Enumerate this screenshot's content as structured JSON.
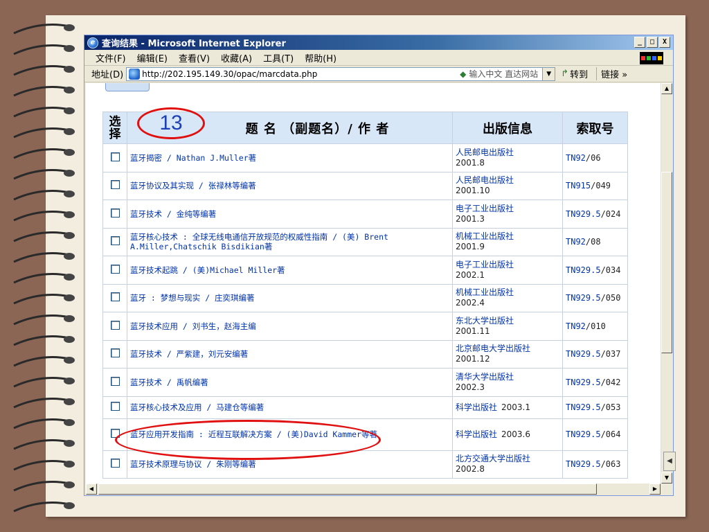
{
  "window": {
    "title": "查询结果 - Microsoft Internet Explorer",
    "minimize": "_",
    "maximize": "□",
    "close": "X"
  },
  "menu": {
    "items": [
      {
        "label": "文件(F)"
      },
      {
        "label": "编辑(E)"
      },
      {
        "label": "查看(V)"
      },
      {
        "label": "收藏(A)"
      },
      {
        "label": "工具(T)"
      },
      {
        "label": "帮助(H)"
      }
    ]
  },
  "address": {
    "label": "地址(D)",
    "url": "http://202.195.149.30/opac/marcdata.php",
    "hint": "输入中文 直达网站",
    "go_label": "转到",
    "links_label": "链接 »"
  },
  "table": {
    "headers": {
      "select": "选 择",
      "title": "题 名 （副题名）/ 作 者",
      "publication": "出版信息",
      "call_number": "索取号"
    },
    "rows": [
      {
        "title": "蓝牙揭密 / Nathan J.Muller著",
        "publisher": "人民邮电出版社",
        "year": "2001.8",
        "call_prefix": "TN92",
        "call_suffix": "/06"
      },
      {
        "title": "蓝牙协议及其实现 / 张禄林等编著",
        "publisher": "人民邮电出版社",
        "year": "2001.10",
        "call_prefix": "TN915",
        "call_suffix": "/049"
      },
      {
        "title": "蓝牙技术 / 金纯等编著",
        "publisher": "电子工业出版社",
        "year": "2001.3",
        "call_prefix": "TN929.5",
        "call_suffix": "/024"
      },
      {
        "title": "蓝牙核心技术 : 全球无线电通信开放规范的权威性指南 / (美) Brent A.Miller,Chatschik Bisdikian著",
        "publisher": "机械工业出版社",
        "year": "2001.9",
        "call_prefix": "TN92",
        "call_suffix": "/08"
      },
      {
        "title": "蓝牙技术起跳 / (美)Michael Miller著",
        "publisher": "电子工业出版社",
        "year": "2002.1",
        "call_prefix": "TN929.5",
        "call_suffix": "/034"
      },
      {
        "title": "蓝牙 : 梦想与现实 / 庄奕琪编著",
        "publisher": "机械工业出版社",
        "year": "2002.4",
        "call_prefix": "TN929.5",
        "call_suffix": "/050"
      },
      {
        "title": "蓝牙技术应用 / 刘书生，赵海主编",
        "publisher": "东北大学出版社",
        "year": "2001.11",
        "call_prefix": "TN92",
        "call_suffix": "/010"
      },
      {
        "title": "蓝牙技术 / 严紫建，刘元安编著",
        "publisher": "北京邮电大学出版社",
        "year": "2001.12",
        "call_prefix": "TN929.5",
        "call_suffix": "/037"
      },
      {
        "title": "蓝牙技术 / 禹帆编著",
        "publisher": "清华大学出版社",
        "year": "2002.3",
        "call_prefix": "TN929.5",
        "call_suffix": "/042"
      },
      {
        "title": "蓝牙核心技术及应用 / 马建仓等编著",
        "publisher": "科学出版社",
        "year": "2003.1",
        "call_prefix": "TN929.5",
        "call_suffix": "/053"
      },
      {
        "title": "蓝牙应用开发指南 : 近程互联解决方案 / (美)David Kammer等著",
        "publisher": "科学出版社",
        "year": "2003.6",
        "call_prefix": "TN929.5",
        "call_suffix": "/064"
      },
      {
        "title": "蓝牙技术原理与协议 / 朱刚等编著",
        "publisher": "北方交通大学出版社",
        "year": "2002.8",
        "call_prefix": "TN929.5",
        "call_suffix": "/063"
      }
    ]
  },
  "annotations": {
    "count": "13",
    "color": "#e01010"
  },
  "colors": {
    "link": "#0033aa",
    "header_bg": "#d8e7f8",
    "titlebar": "#0a246a"
  }
}
